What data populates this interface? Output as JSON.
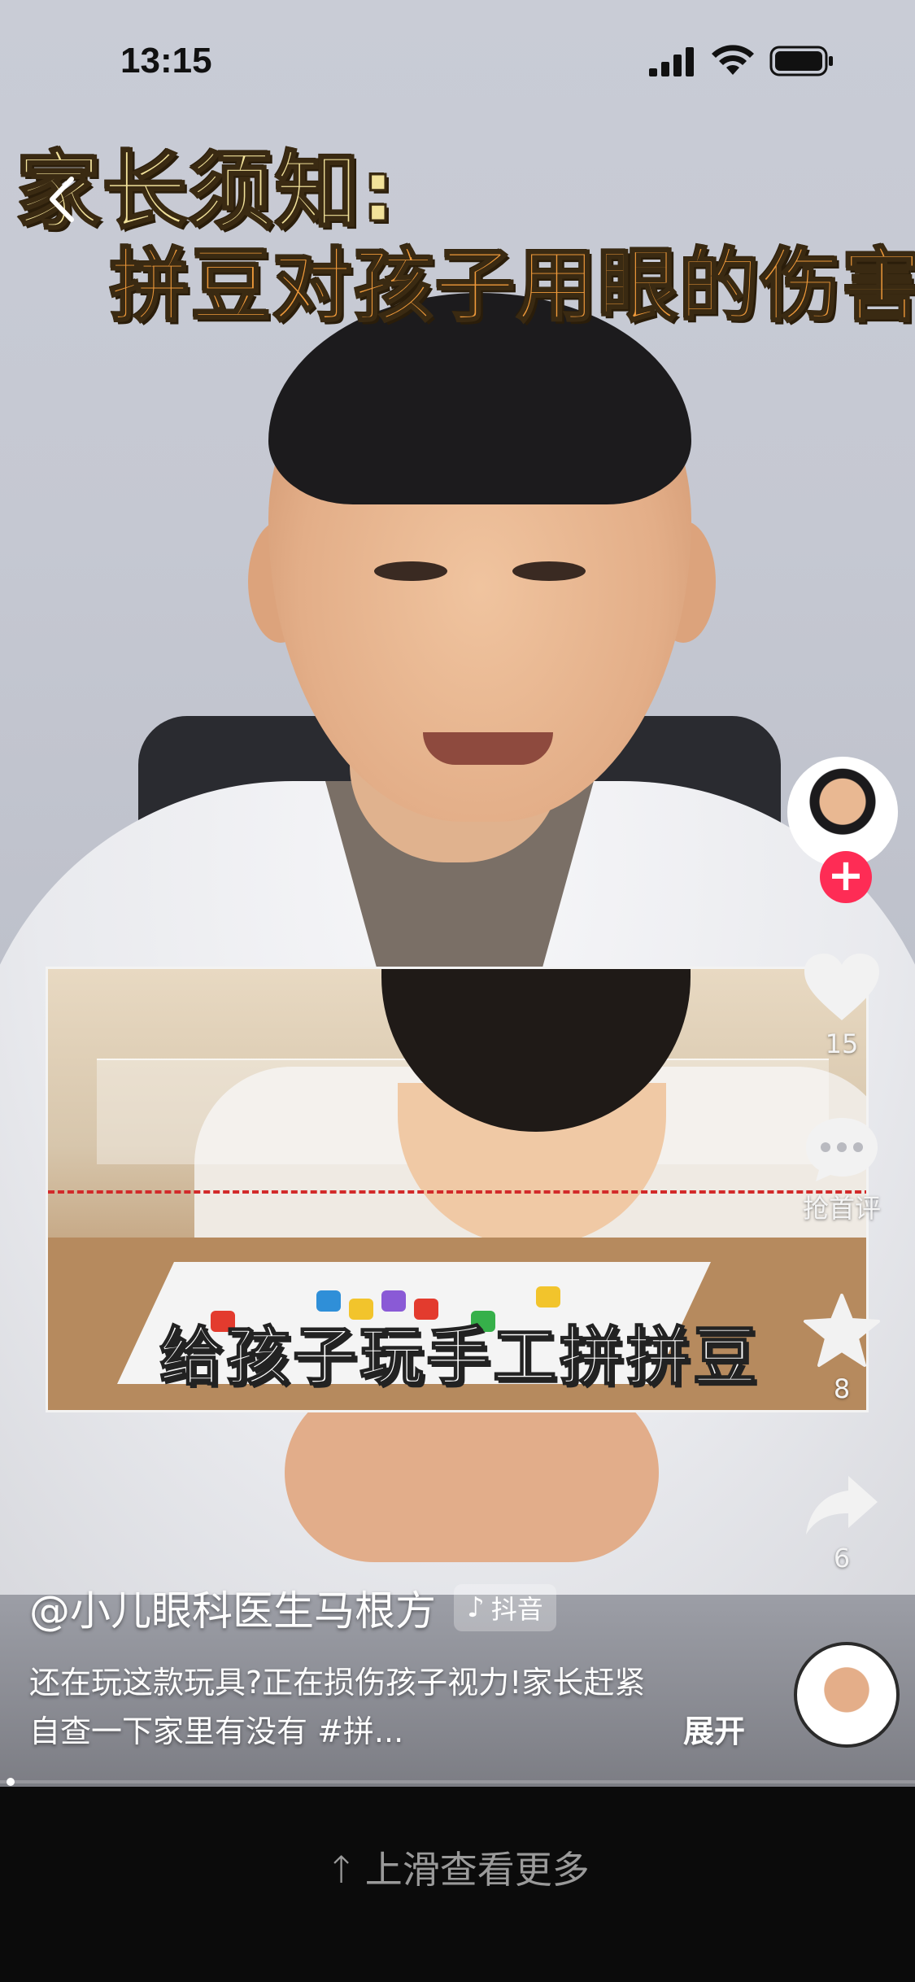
{
  "status_bar": {
    "time": "13:15"
  },
  "video": {
    "title_line1": "家长须知:",
    "title_line2": "拼豆对孩子用眼的伤害",
    "inset_caption": "给孩子玩手工拼拼豆"
  },
  "actions": {
    "follow_symbol": "+",
    "like_count": "15",
    "comment_label": "抢首评",
    "favorite_count": "8",
    "share_count": "6"
  },
  "post": {
    "author": "@小儿眼科医生马根方",
    "badge_logo": "♪",
    "badge_label": "抖音",
    "description": "还在玩这款玩具?正在损伤孩子视力!家长赶紧自查一下家里有没有 #拼...",
    "expand_label": "展开"
  },
  "footer": {
    "arrow": "↑",
    "swipe_hint": "上滑查看更多"
  },
  "colors": {
    "follow_red": "#fe2c55",
    "title_yellow": "#f2e29a",
    "title_orange": "#f09a3a",
    "dashed_line_red": "#d22a2a"
  },
  "icons": [
    "back-icon",
    "signal-icon",
    "wifi-icon",
    "battery-icon",
    "heart-icon",
    "comment-icon",
    "star-icon",
    "share-icon"
  ]
}
